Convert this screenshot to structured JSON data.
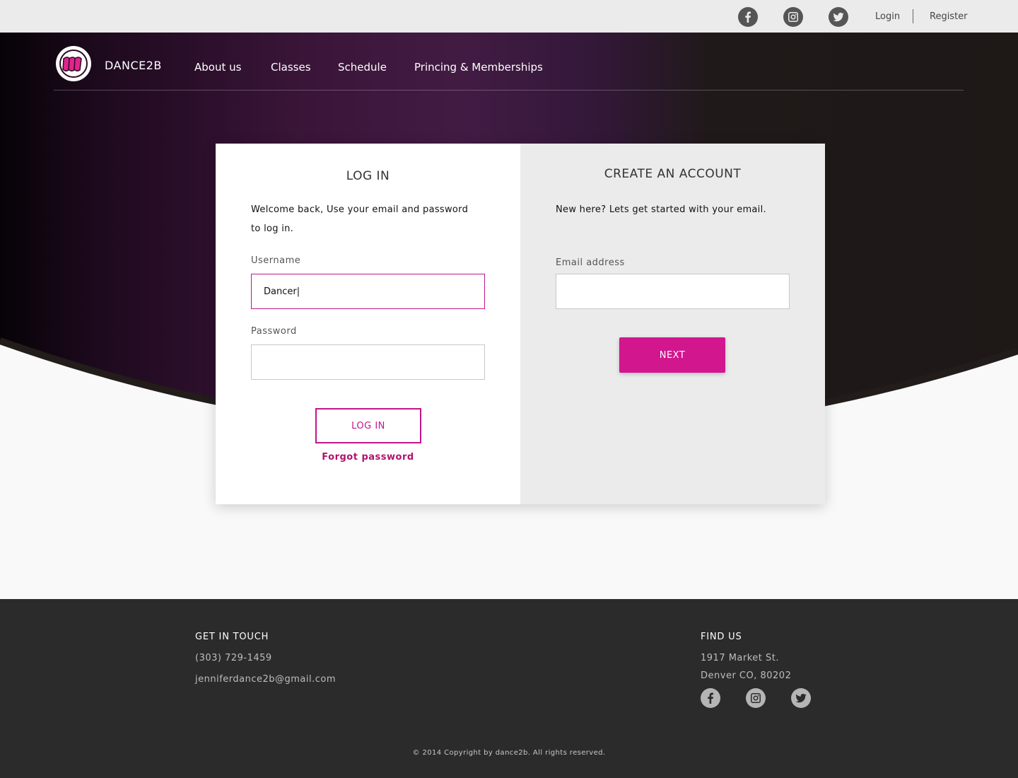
{
  "topbar": {
    "social": [
      {
        "icon": "facebook-icon"
      },
      {
        "icon": "instagram-icon"
      },
      {
        "icon": "twitter-icon"
      }
    ],
    "login_label": "Login",
    "register_label": "Register"
  },
  "nav": {
    "brand": "DANCE2B",
    "links": [
      "About us",
      "Classes",
      "Schedule",
      "Princing & Memberships"
    ]
  },
  "login": {
    "title": "LOG IN",
    "description_line1": "Welcome back, Use your email and password",
    "description_line2": "to log in.",
    "username_label": "Username",
    "username_value": "Dancer|",
    "password_label": "Password",
    "password_value": "",
    "submit_label": "LOG IN",
    "forgot_label": "Forgot password"
  },
  "register": {
    "title": "CREATE AN ACCOUNT",
    "description": "New here? Lets get started with your email.",
    "email_label": "Email address",
    "email_value": "",
    "next_label": "NEXT"
  },
  "footer": {
    "contact_heading": "GET IN TOUCH",
    "phone": "(303) 729-1459",
    "email": "jenniferdance2b@gmail.com",
    "find_heading": "FIND US",
    "address_line1": "1917 Market St.",
    "address_line2": "Denver CO, 80202",
    "copyright": "© 2014 Copyright by dance2b. All rights reserved."
  },
  "colors": {
    "accent": "#d1168e",
    "hero_dark": "#1e1917",
    "hero_purple": "#3f1a40",
    "footer_bg": "#2b2b2b"
  }
}
